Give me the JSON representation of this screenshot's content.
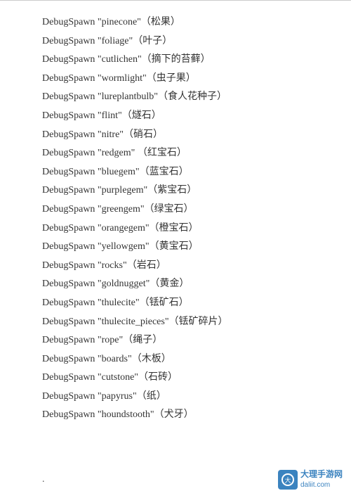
{
  "divider": true,
  "items": [
    {
      "id": "pinecone",
      "key": "\"pinecone\"",
      "value": "（松果）"
    },
    {
      "id": "foliage",
      "key": "\"foliage\"",
      "value": "（叶子）"
    },
    {
      "id": "cutlichen",
      "key": "\"cutlichen\"",
      "value": "（摘下的苔藓）"
    },
    {
      "id": "wormlight",
      "key": "\"wormlight\"",
      "value": "（虫子果）"
    },
    {
      "id": "lureplantbulb",
      "key": "\"lureplantbulb\"",
      "value": "（食人花种子）"
    },
    {
      "id": "flint",
      "key": "\"flint\"",
      "value": "（燧石）"
    },
    {
      "id": "nitre",
      "key": "\"nitre\"",
      "value": "（硝石）"
    },
    {
      "id": "redgem",
      "key": "\"redgem\"",
      "value": "  （红宝石）"
    },
    {
      "id": "bluegem",
      "key": "\"bluegem\"",
      "value": "（蓝宝石）"
    },
    {
      "id": "purplegem",
      "key": "\"purplegem\"",
      "value": "（紫宝石）"
    },
    {
      "id": "greengem",
      "key": "\"greengem\"",
      "value": "（绿宝石）"
    },
    {
      "id": "orangegem",
      "key": "\"orangegem\"",
      "value": "（橙宝石）"
    },
    {
      "id": "yellowgem",
      "key": "\"yellowgem\"",
      "value": "（黄宝石）"
    },
    {
      "id": "rocks",
      "key": "\"rocks\"",
      "value": "（岩石）"
    },
    {
      "id": "goldnugget",
      "key": "\"goldnugget\"",
      "value": "（黄金）"
    },
    {
      "id": "thulecite",
      "key": "\"thulecite\"",
      "value": "（铥矿石）"
    },
    {
      "id": "thulecite_pieces",
      "key": "\"thulecite_pieces\"",
      "value": "（铥矿碎片）"
    },
    {
      "id": "rope",
      "key": "\"rope\"",
      "value": "（绳子）"
    },
    {
      "id": "boards",
      "key": "\"boards\"",
      "value": "（木板）"
    },
    {
      "id": "cutstone",
      "key": "\"cutstone\"",
      "value": "（石砖）"
    },
    {
      "id": "papyrus",
      "key": "\"papyrus\"",
      "value": "（纸）"
    },
    {
      "id": "houndstooth",
      "key": "\"houndstooth\"",
      "value": "（犬牙）"
    }
  ],
  "prefix": "DebugSpawn ",
  "dot": ".",
  "watermark": {
    "line1": "大理手游网",
    "line2": "daliit.com"
  }
}
